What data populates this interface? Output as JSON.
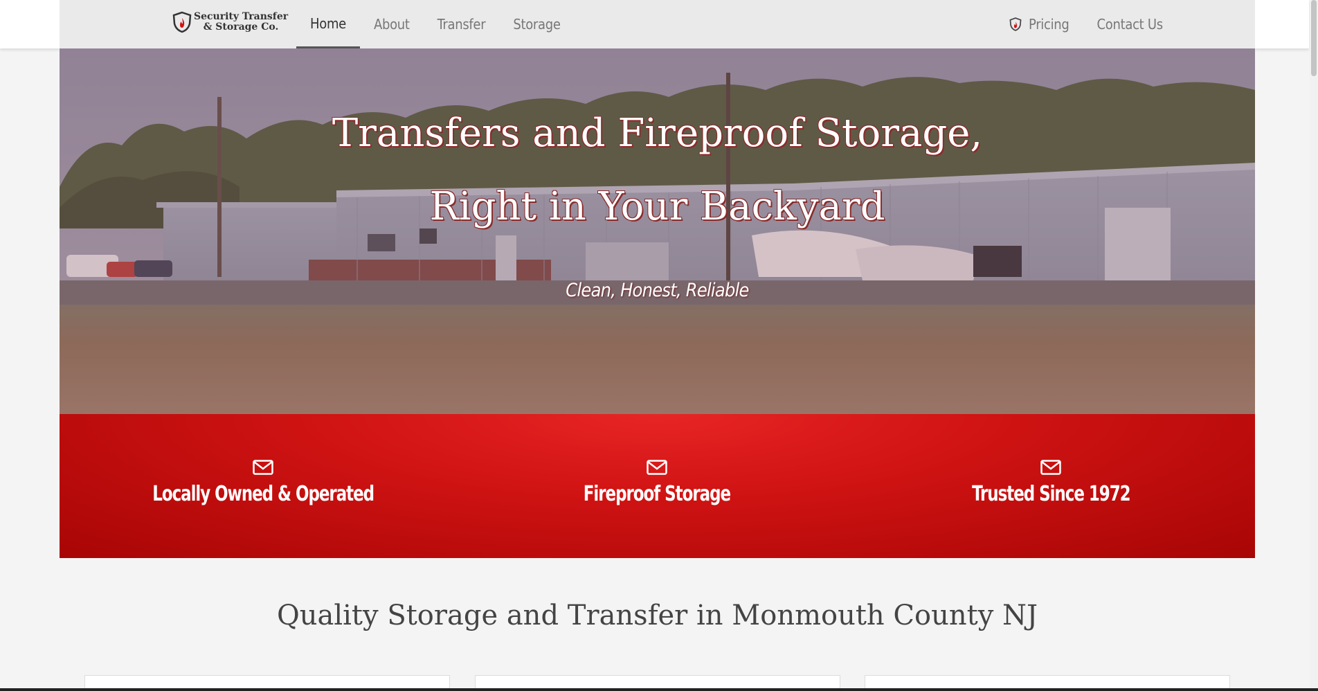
{
  "brand": {
    "logo_line1": "Security Transfer",
    "logo_line2": "& Storage Co.",
    "accent_color": "#d01313"
  },
  "nav": {
    "left": [
      {
        "label": "Home",
        "active": true
      },
      {
        "label": "About",
        "active": false
      },
      {
        "label": "Transfer",
        "active": false
      },
      {
        "label": "Storage",
        "active": false
      }
    ],
    "right": [
      {
        "label": "Pricing",
        "icon": "shield-flame-icon"
      },
      {
        "label": "Contact Us"
      }
    ]
  },
  "hero": {
    "title_line1": "Transfers and Fireproof Storage,",
    "title_line2": "Right in Your Backyard",
    "tagline": "Clean, Honest, Reliable"
  },
  "features": [
    {
      "icon": "envelope-icon",
      "label": "Locally Owned & Operated"
    },
    {
      "icon": "envelope-icon",
      "label": "Fireproof Storage"
    },
    {
      "icon": "envelope-icon",
      "label": "Trusted Since 1972"
    }
  ],
  "section": {
    "heading": "Quality Storage and Transfer in Monmouth County NJ"
  }
}
